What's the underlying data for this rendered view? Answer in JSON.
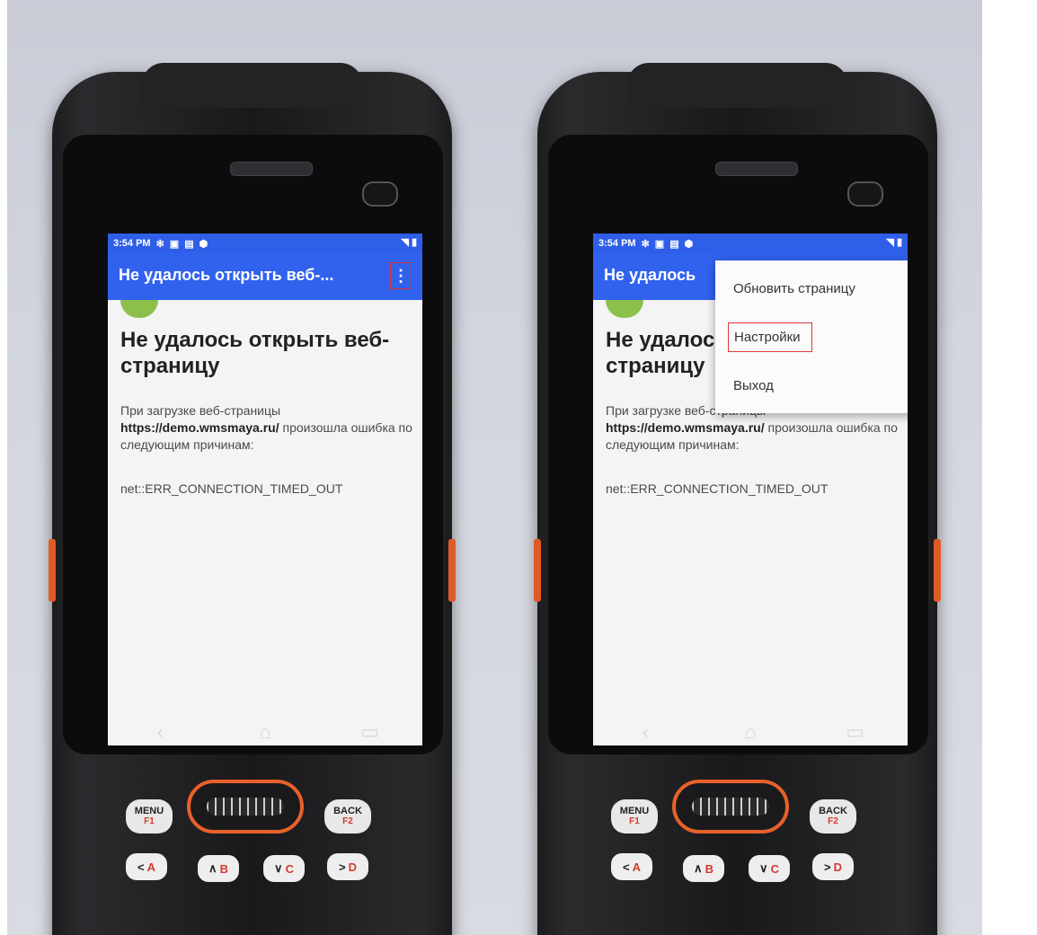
{
  "statusbar": {
    "time": "3:54 PM",
    "icons": [
      "gear-icon",
      "notification-icon",
      "keyboard-icon",
      "shield-icon"
    ],
    "right_icons": [
      "wifi-icon",
      "battery-icon"
    ]
  },
  "appbar": {
    "title": "Не удалось открыть веб-...",
    "title_partial": "Не удалось",
    "overflow_icon": "⋮"
  },
  "content": {
    "heading": "Не удалось открыть веб-страницу",
    "heading_partial_1": "Не удалос",
    "heading_partial_2": "страницу",
    "desc_prefix": "При загрузке веб-страницы",
    "desc_url": "https://demo.wmsmaya.ru/",
    "desc_suffix": "произошла ошибка по следующим причинам:",
    "error": "net::ERR_CONNECTION_TIMED_OUT"
  },
  "menu": {
    "items": [
      {
        "label": "Обновить страницу"
      },
      {
        "label": "Настройки"
      },
      {
        "label": "Выход"
      }
    ]
  },
  "navbar": {
    "back": "‹",
    "home": "⌂",
    "recents": "▭"
  },
  "keys": {
    "menu": "MENU",
    "menu_sub": "F1",
    "back": "BACK",
    "back_sub": "F2",
    "a": "A",
    "b": "B",
    "c": "C",
    "d": "D"
  },
  "colors": {
    "statusbar": "#2f5ee8",
    "appbar": "#3162ee",
    "highlight": "#e03535",
    "android_green": "#8cc04a",
    "accent_orange": "#e7612a"
  }
}
